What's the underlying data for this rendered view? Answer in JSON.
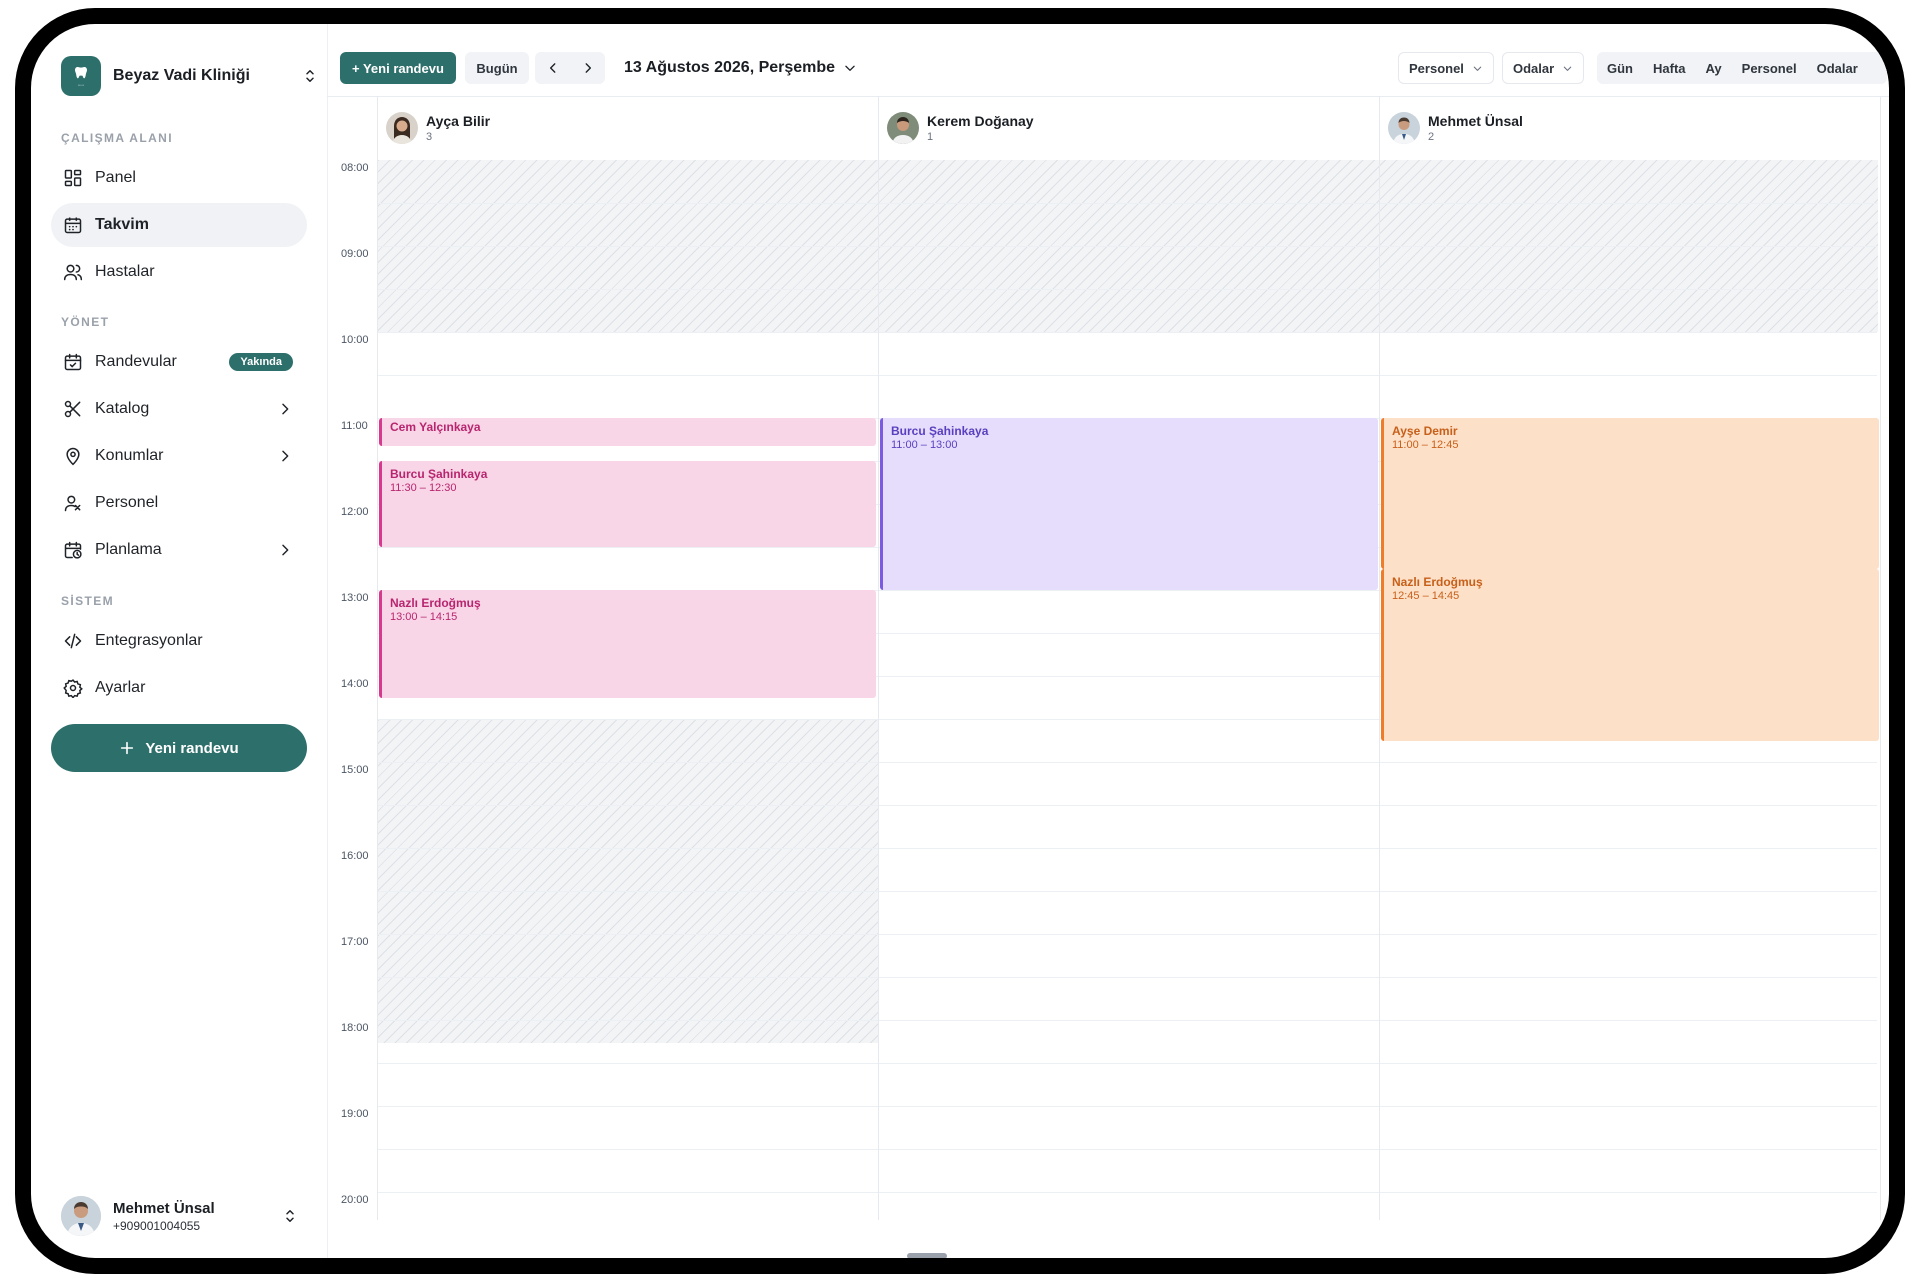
{
  "sidebar": {
    "clinic_name": "Beyaz Vadi Kliniği",
    "sections": {
      "workspace": "ÇALIŞMA ALANI",
      "manage": "YÖNET",
      "system": "SİSTEM"
    },
    "items": [
      {
        "label": "Panel",
        "icon": "dashboard-icon"
      },
      {
        "label": "Takvim",
        "icon": "calendar-icon",
        "active": true
      },
      {
        "label": "Hastalar",
        "icon": "users-icon"
      },
      {
        "label": "Randevular",
        "icon": "calendar-check-icon",
        "badge": "Yakında"
      },
      {
        "label": "Katalog",
        "icon": "scissors-icon"
      },
      {
        "label": "Konumlar",
        "icon": "location-pin-icon"
      },
      {
        "label": "Personel",
        "icon": "staff-icon"
      },
      {
        "label": "Planlama",
        "icon": "calendar-clock-icon"
      },
      {
        "label": "Entegrasyonlar",
        "icon": "code-icon"
      },
      {
        "label": "Ayarlar",
        "icon": "gear-icon"
      }
    ],
    "new_appointment": "Yeni randevu",
    "user": {
      "name": "Mehmet Ünsal",
      "phone": "+909001004055"
    }
  },
  "toolbar": {
    "new_appointment": "+ Yeni randevu",
    "today": "Bugün",
    "date_title": "13 Ağustos 2026, Perşembe",
    "filter_staff": "Personel",
    "filter_rooms": "Odalar",
    "views": [
      "Gün",
      "Hafta",
      "Ay",
      "Personel",
      "Odalar"
    ]
  },
  "calendar": {
    "hours": [
      "08:00",
      "09:00",
      "10:00",
      "11:00",
      "12:00",
      "13:00",
      "14:00",
      "15:00",
      "16:00",
      "17:00",
      "18:00",
      "19:00",
      "20:00"
    ],
    "staff": [
      {
        "name": "Ayça Bilir",
        "count": "3"
      },
      {
        "name": "Kerem Doğanay",
        "count": "1"
      },
      {
        "name": "Mehmet Ünsal",
        "count": "2"
      }
    ],
    "events": [
      {
        "staff": 0,
        "patient": "Cem Yalçınkaya",
        "time": "",
        "color": "#d63a8e"
      },
      {
        "staff": 0,
        "patient": "Burcu Şahinkaya",
        "time": "11:30 – 12:30",
        "color": "#d63a8e"
      },
      {
        "staff": 0,
        "patient": "Nazlı Erdoğmuş",
        "time": "13:00 – 14:15",
        "color": "#d63a8e"
      },
      {
        "staff": 1,
        "patient": "Burcu Şahinkaya",
        "time": "11:00 – 13:00",
        "color": "#7b5ce0"
      },
      {
        "staff": 2,
        "patient": "Ayşe Demir",
        "time": "11:00 – 12:45",
        "color": "#ef7c28"
      },
      {
        "staff": 2,
        "patient": "Nazlı Erdoğmuş",
        "time": "12:45 – 14:45",
        "color": "#ef7c28"
      }
    ]
  },
  "colors": {
    "brand": "#2d6f6b",
    "pink": "#d63a8e",
    "purple": "#7b5ce0",
    "orange": "#ef7c28"
  }
}
